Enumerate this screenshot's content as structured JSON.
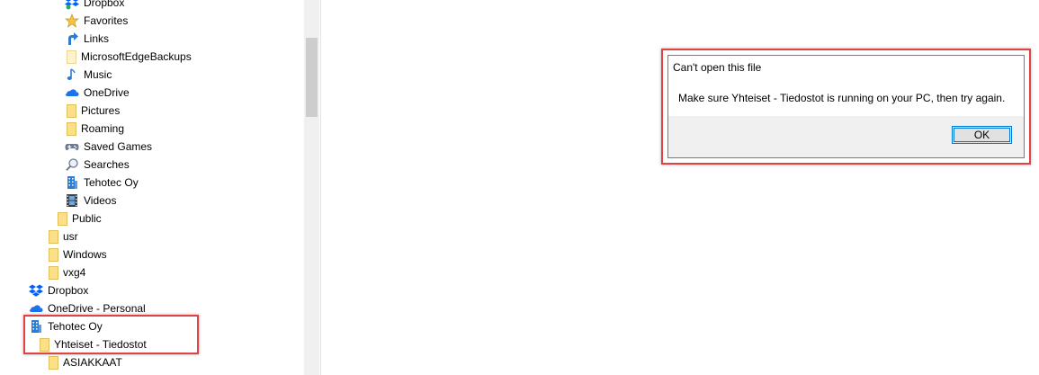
{
  "nav_tree": {
    "items": [
      {
        "label": "Dropbox",
        "icon": "dropbox-icon"
      },
      {
        "label": "Favorites",
        "icon": "star-icon"
      },
      {
        "label": "Links",
        "icon": "link-arrow-icon"
      },
      {
        "label": "MicrosoftEdgeBackups",
        "icon": "folder-icon"
      },
      {
        "label": "Music",
        "icon": "music-note-icon"
      },
      {
        "label": "OneDrive",
        "icon": "cloud-icon"
      },
      {
        "label": "Pictures",
        "icon": "folder-icon"
      },
      {
        "label": "Roaming",
        "icon": "folder-icon"
      },
      {
        "label": "Saved Games",
        "icon": "gamepad-icon"
      },
      {
        "label": "Searches",
        "icon": "magnifier-icon"
      },
      {
        "label": "Tehotec Oy",
        "icon": "building-icon"
      },
      {
        "label": "Videos",
        "icon": "film-icon"
      },
      {
        "label": "Public",
        "icon": "folder-icon"
      },
      {
        "label": "usr",
        "icon": "folder-icon"
      },
      {
        "label": "Windows",
        "icon": "folder-icon"
      },
      {
        "label": "vxg4",
        "icon": "folder-icon"
      },
      {
        "label": "Dropbox",
        "icon": "dropbox-icon"
      },
      {
        "label": "OneDrive - Personal",
        "icon": "cloud-icon"
      },
      {
        "label": "Tehotec Oy",
        "icon": "building-icon"
      },
      {
        "label": "Yhteiset - Tiedostot",
        "icon": "folder-icon"
      },
      {
        "label": "ASIAKKAAT",
        "icon": "folder-icon"
      }
    ]
  },
  "dialog": {
    "title": "Can't open this file",
    "message": "Make sure Yhteiset - Tiedostot is running on your PC, then try again.",
    "ok_label": "OK"
  },
  "colors": {
    "highlight": "#e04343",
    "accent": "#0078d7",
    "folder": "#fbe089",
    "onedrive": "#1a73e8",
    "dropbox": "#0061fe"
  }
}
